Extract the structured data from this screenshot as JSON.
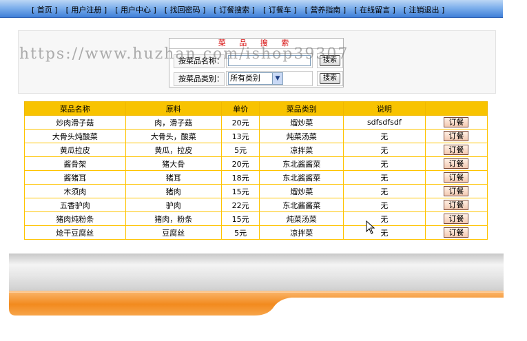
{
  "nav": {
    "items": [
      {
        "label": "首页"
      },
      {
        "label": "用户注册"
      },
      {
        "label": "用户中心"
      },
      {
        "label": "找回密码"
      },
      {
        "label": "订餐搜索"
      },
      {
        "label": "订餐车"
      },
      {
        "label": "营养指南"
      },
      {
        "label": "在线留言"
      },
      {
        "label": "注销退出"
      }
    ]
  },
  "search": {
    "title": "菜 品 搜 索",
    "name_label": "按菜品名称：",
    "name_value": "",
    "category_label": "按菜品类别：",
    "category_selected": "所有类别",
    "name_button": "搜索",
    "category_button": "搜索"
  },
  "watermark": "https://www.huzhan.com/ishop39307",
  "table": {
    "headers": [
      "菜品名称",
      "原料",
      "单价",
      "菜品类别",
      "说明",
      ""
    ],
    "order_label": "订餐",
    "rows": [
      {
        "name": "炒肉滑子菇",
        "material": "肉，滑子菇",
        "price": "20元",
        "category": "熘炒菜",
        "desc": "sdfsdfsdf"
      },
      {
        "name": "大骨头炖酸菜",
        "material": "大骨头，酸菜",
        "price": "13元",
        "category": "炖菜汤菜",
        "desc": "无"
      },
      {
        "name": "黄瓜拉皮",
        "material": "黄瓜，拉皮",
        "price": "5元",
        "category": "凉拌菜",
        "desc": "无"
      },
      {
        "name": "酱骨架",
        "material": "猪大骨",
        "price": "20元",
        "category": "东北酱酱菜",
        "desc": "无"
      },
      {
        "name": "酱猪耳",
        "material": "猪耳",
        "price": "18元",
        "category": "东北酱酱菜",
        "desc": "无"
      },
      {
        "name": "木须肉",
        "material": "猪肉",
        "price": "15元",
        "category": "熘炒菜",
        "desc": "无"
      },
      {
        "name": "五香驴肉",
        "material": "驴肉",
        "price": "22元",
        "category": "东北酱酱菜",
        "desc": "无"
      },
      {
        "name": "猪肉炖粉条",
        "material": "猪肉，粉条",
        "price": "15元",
        "category": "炖菜汤菜",
        "desc": "无"
      },
      {
        "name": "炝干豆腐丝",
        "material": "豆腐丝",
        "price": "5元",
        "category": "凉拌菜",
        "desc": "无"
      }
    ]
  },
  "colors": {
    "nav_blue": "#3f7fd8",
    "table_header": "#f8c300",
    "search_title": "#d40000",
    "footer_orange": "#f28a1e"
  }
}
